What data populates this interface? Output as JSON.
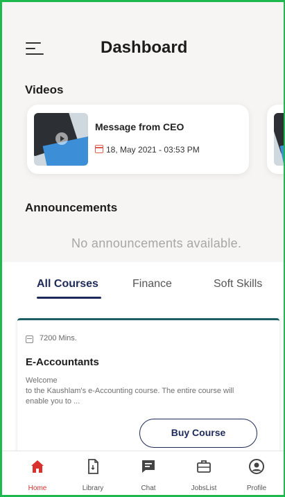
{
  "header": {
    "title": "Dashboard",
    "menu_icon": "menu-icon"
  },
  "videos": {
    "label": "Videos",
    "items": [
      {
        "title": "Message from CEO",
        "date": "18, May 2021 - 03:53 PM"
      }
    ]
  },
  "announcements": {
    "label": "Announcements",
    "empty_text": "No announcements available."
  },
  "tabs": [
    {
      "label": "All Courses",
      "active": true
    },
    {
      "label": "Finance",
      "active": false
    },
    {
      "label": "Soft Skills",
      "active": false
    }
  ],
  "course": {
    "duration": "7200 Mins.",
    "name": "E-Accountants",
    "description_line1": "Welcome",
    "description_line2": "to the Kaushlam's e-Accounting course. The entire course will enable you to ...",
    "buy_label": "Buy Course"
  },
  "bottom_nav": [
    {
      "label": "Home",
      "icon": "home-icon",
      "active": true
    },
    {
      "label": "Library",
      "icon": "library-icon",
      "active": false
    },
    {
      "label": "Chat",
      "icon": "chat-icon",
      "active": false
    },
    {
      "label": "JobsList",
      "icon": "briefcase-icon",
      "active": false
    },
    {
      "label": "Profile",
      "icon": "profile-icon",
      "active": false
    }
  ],
  "colors": {
    "frame_border": "#1fb84f",
    "accent_navy": "#1d2a59",
    "active_red": "#d8322f",
    "calendar_red": "#e25b4f",
    "card_top_border": "#1b5e63"
  }
}
